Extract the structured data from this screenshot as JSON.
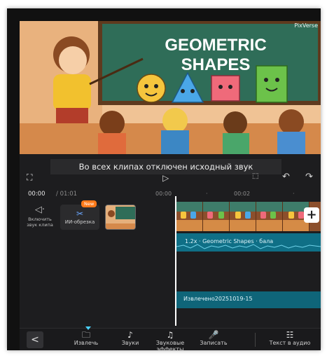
{
  "preview": {
    "board_title_line1": "GEOMETRIC",
    "board_title_line2": "SHAPES",
    "watermark": "PixVerse"
  },
  "editor": {
    "banner_text": "Во всех клипах отключен исходный звук",
    "current_time": "00:00",
    "total_time": "/ 01:01",
    "ticks": [
      "00:00",
      "00:02"
    ],
    "sound_toggle_label": "Включить звук клипа",
    "ai_cut_label": "ИИ-обрезка",
    "new_badge": "New",
    "audio_label": "1.2x · Geometric Shapes · бала",
    "extract_label": "Извлечено20251019-15",
    "add_clip_symbol": "+"
  },
  "toolbar": {
    "back_symbol": "<",
    "items": [
      {
        "label": "Извлечь",
        "icon": "folder-icon"
      },
      {
        "label": "Звуки",
        "icon": "music-note-icon"
      },
      {
        "label": "Звуковые эффекты",
        "icon": "sound-effects-icon"
      },
      {
        "label": "Записать",
        "icon": "microphone-icon"
      },
      {
        "label": "Текст в аудио",
        "icon": "text-to-audio-icon"
      }
    ]
  },
  "colors": {
    "accent": "#4ad2ff",
    "audio_track": "#0f6f86",
    "new_badge": "#ff7a1a"
  }
}
